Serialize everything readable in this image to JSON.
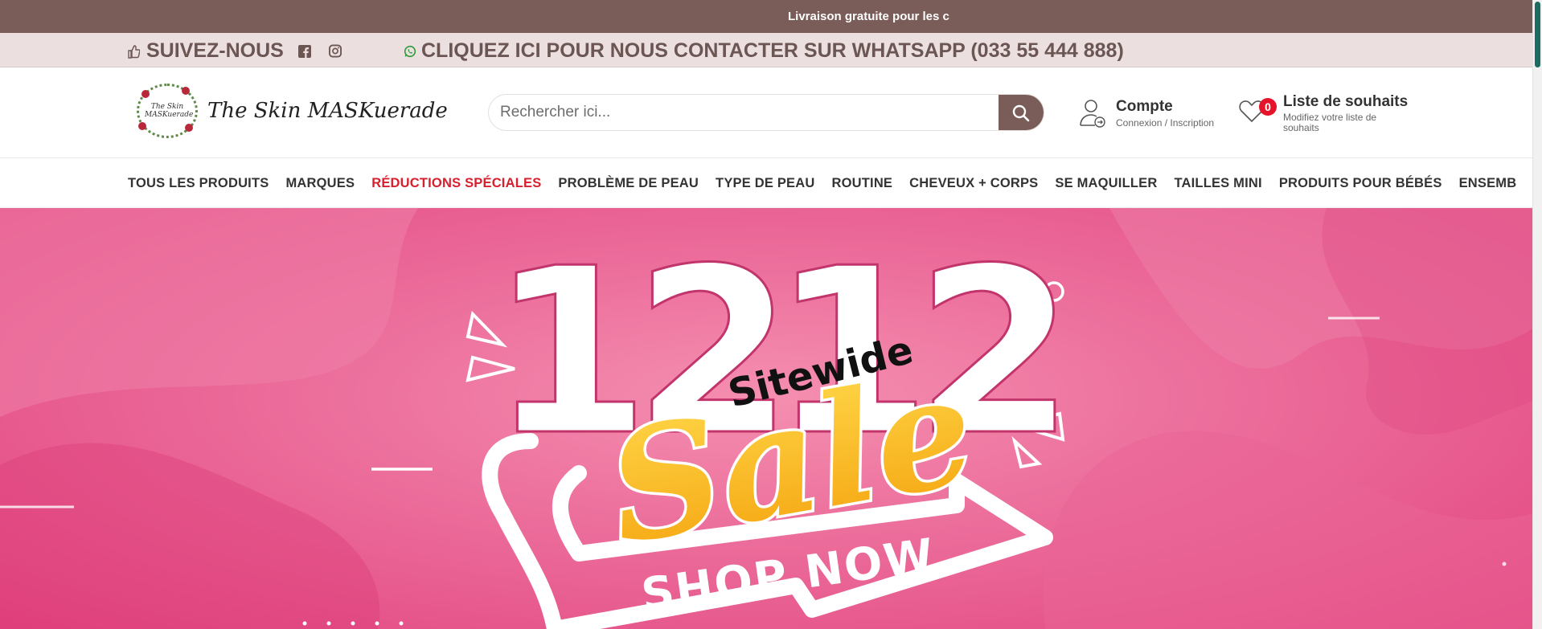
{
  "announcement": {
    "text": "Livraison gratuite pour les c"
  },
  "social_bar": {
    "follow_label": "SUIVEZ-NOUS",
    "whatsapp_label": "CLIQUEZ ICI POUR NOUS CONTACTER SUR WHATSAPP (033 55 444 888)"
  },
  "header": {
    "logo_emblem_text": "The Skin MASKuerade",
    "logo_name": "The Skin MASKuerade",
    "search_placeholder": "Rechercher ici...",
    "account": {
      "title": "Compte",
      "subtitle": "Connexion / Inscription"
    },
    "wishlist": {
      "count": "0",
      "title": "Liste de souhaits",
      "subtitle": "Modifiez votre liste de souhaits"
    }
  },
  "nav": {
    "items": [
      "TOUS LES PRODUITS",
      "MARQUES",
      "RÉDUCTIONS SPÉCIALES",
      "PROBLÈME DE PEAU",
      "TYPE DE PEAU",
      "ROUTINE",
      "CHEVEUX + CORPS",
      "SE MAQUILLER",
      "TAILLES MINI",
      "PRODUITS POUR BÉBÉS",
      "ENSEMB"
    ]
  },
  "hero": {
    "number_left": "12",
    "number_right": "12",
    "tagline": "Sitewide",
    "headline": "Sale",
    "cta": "SHOP NOW"
  },
  "colors": {
    "brand": "#7a5c58",
    "promo_red": "#d6202d",
    "hero_pink": "#e2457f",
    "sale_yellow": "#fbbf1a"
  }
}
